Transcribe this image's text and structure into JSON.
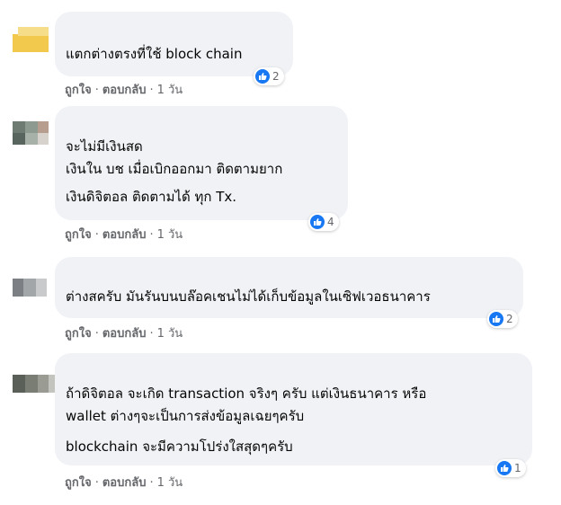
{
  "comments": [
    {
      "lines": [
        "แตกต่างตรงที่ใช้ block chain"
      ],
      "reaction_icon": "like-icon",
      "reaction_count": "2",
      "like_label": "ถูกใจ",
      "reply_label": "ตอบกลับ",
      "timestamp": "1 วัน"
    },
    {
      "lines": [
        "จะไม่มีเงินสด",
        "เงินใน บช เมื่อเบิกออกมา ติดตามยาก",
        "เงินดิจิตอล ติดตามได้ ทุก Tx."
      ],
      "reaction_icon": "like-icon",
      "reaction_count": "4",
      "like_label": "ถูกใจ",
      "reply_label": "ตอบกลับ",
      "timestamp": "1 วัน"
    },
    {
      "lines": [
        "ต่างสครับ มันรันบนบล๊อคเชนไม่ได้เก็บข้อมูลในเซิฟเวอธนาคาร"
      ],
      "reaction_icon": "like-icon",
      "reaction_count": "2",
      "like_label": "ถูกใจ",
      "reply_label": "ตอบกลับ",
      "timestamp": "1 วัน"
    },
    {
      "lines": [
        "ถ้าดิจิตอล จะเกิด transaction จริงๆ ครับ แต่เงินธนาคาร หรือ",
        "wallet ต่างๆจะเป็นการส่งข้อมูลเฉยๆครับ",
        "blockchain จะมีความโปร่งใสสุดๆครับ"
      ],
      "reaction_icon": "like-icon",
      "reaction_count": "1",
      "like_label": "ถูกใจ",
      "reply_label": "ตอบกลับ",
      "timestamp": "1 วัน"
    }
  ],
  "colors": {
    "bubble": "#f0f2f5",
    "like_blue": "#1877f2",
    "meta_text": "#65676b"
  }
}
